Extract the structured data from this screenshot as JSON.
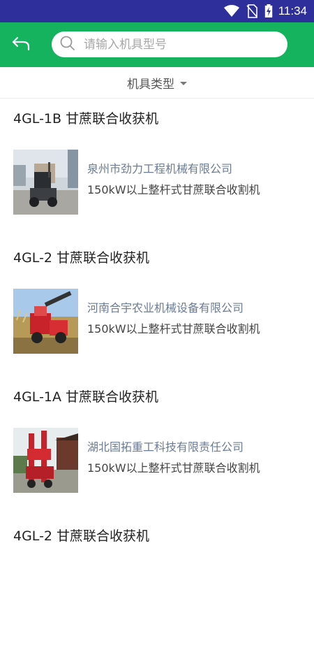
{
  "status_bar": {
    "time": "11:34",
    "icons": [
      "wifi-icon",
      "no-sim-icon",
      "battery-charging-icon"
    ]
  },
  "header": {
    "back_icon": "back-arrow-icon",
    "search": {
      "placeholder": "请输入机具型号",
      "value": ""
    }
  },
  "filter": {
    "label": "机具类型"
  },
  "items": [
    {
      "title": "4GL-1B 甘蔗联合收获机",
      "company": "泉州市劲力工程机械有限公司",
      "spec": "150kW以上整杆式甘蔗联合收割机"
    },
    {
      "title": "4GL-2 甘蔗联合收获机",
      "company": "河南合宇农业机械设备有限公司",
      "spec": "150kW以上整杆式甘蔗联合收割机"
    },
    {
      "title": "4GL-1A 甘蔗联合收获机",
      "company": "湖北国拓重工科技有限责任公司",
      "spec": "150kW以上整杆式甘蔗联合收割机"
    },
    {
      "title": "4GL-2 甘蔗联合收获机",
      "company": "",
      "spec": ""
    }
  ],
  "colors": {
    "status_bar": "#2f2f9c",
    "app_bar": "#16b35f",
    "company_text": "#6c7b95"
  }
}
